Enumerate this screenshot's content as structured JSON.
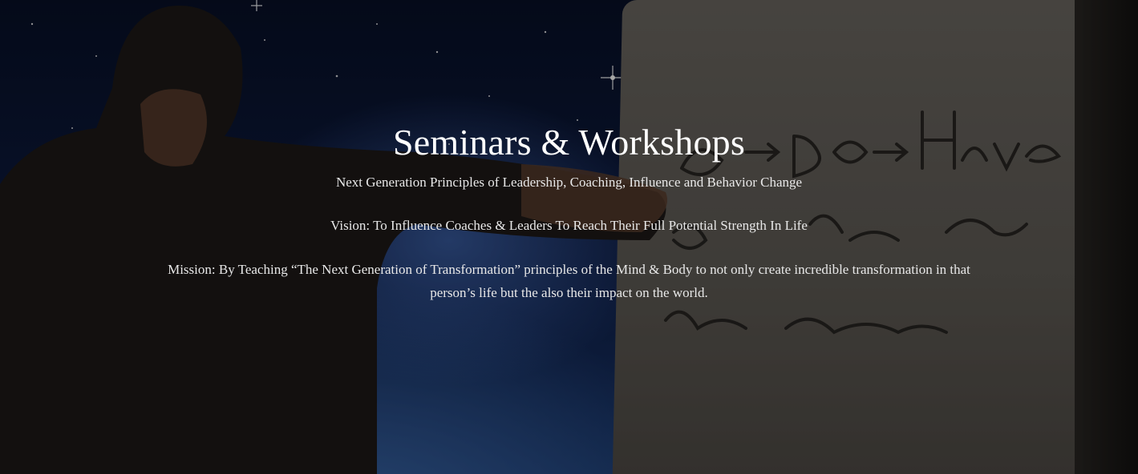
{
  "hero": {
    "title": "Seminars & Workshops",
    "subtitle": "Next Generation Principles of Leadership, Coaching, Influence and Behavior Change",
    "vision": "Vision: To Influence Coaches & Leaders To Reach Their Full Potential Strength In Life",
    "mission": "Mission: By Teaching “The Next Generation of Transformation” principles of the Mind & Body to not only create incredible transformation in that person’s life but the also their impact on the world."
  },
  "background": {
    "flipchart_words": [
      "Be → Do → Have",
      "Beliefs",
      "Actions",
      "Story",
      "being",
      "movement"
    ],
    "colors": {
      "text": "#ffffff",
      "body_text": "#e8e8e8",
      "space": "#0d1c44",
      "paper": "#6c6862"
    }
  }
}
